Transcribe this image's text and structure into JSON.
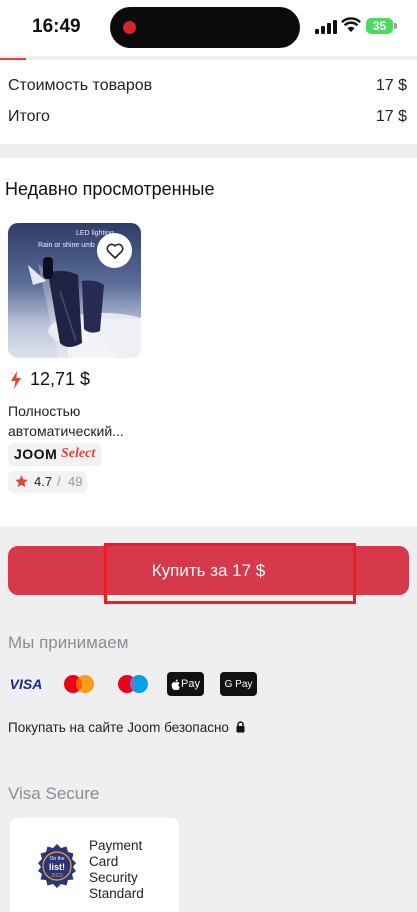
{
  "status_bar": {
    "time": "16:49",
    "battery": "35"
  },
  "summary": {
    "rows": [
      {
        "label": "Стоимость товаров",
        "value": "17 $"
      },
      {
        "label": "Итого",
        "value": "17 $"
      }
    ]
  },
  "recent": {
    "title": "Недавно просмотренные",
    "product": {
      "image_caption_1": "LED lighting",
      "image_caption_2": "Rain or shine umb",
      "price": "12,71 $",
      "name_line1": "Полностью",
      "name_line2": "автоматический...",
      "badge_brand": "JOOM",
      "badge_select": "Select",
      "rating": "4.7",
      "rating_sep": "/",
      "reviews": "49"
    }
  },
  "buy_button": {
    "label": "Купить за 17 $"
  },
  "payments": {
    "title": "Мы принимаем",
    "methods": [
      "visa",
      "mastercard",
      "maestro",
      "apple-pay",
      "google-pay"
    ],
    "visa_label": "VISA",
    "apple_pay_label": "Pay",
    "google_pay_label": "G Pay",
    "secure_note": "Покупать на сайте Joom безопасно"
  },
  "visa_secure": {
    "title": "Visa Secure",
    "pci_seal_top": "On the",
    "pci_seal_mid": "list!",
    "pci_seal_year": "2023",
    "pci_lines": [
      "Payment",
      "Card",
      "Security",
      "Standard"
    ]
  },
  "colors": {
    "accent": "#e8423d",
    "buy_button": "#d6394a",
    "highlight_frame": "#ee1c24",
    "battery": "#4cd964"
  }
}
